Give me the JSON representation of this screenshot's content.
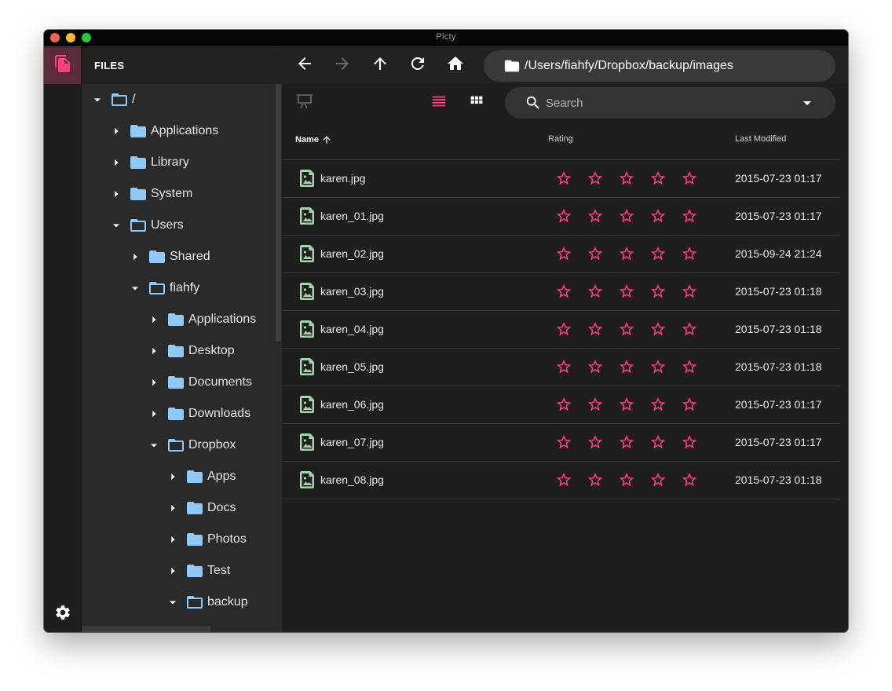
{
  "window": {
    "title": "Picty"
  },
  "colors": {
    "accent": "#ff4081",
    "folder": "#90caf9",
    "file_icon": "#a5d6a7"
  },
  "sidebar": {
    "title": "FILES",
    "tree": [
      {
        "label": "/",
        "depth": 0,
        "expanded": true
      },
      {
        "label": "Applications",
        "depth": 1,
        "expanded": false
      },
      {
        "label": "Library",
        "depth": 1,
        "expanded": false
      },
      {
        "label": "System",
        "depth": 1,
        "expanded": false
      },
      {
        "label": "Users",
        "depth": 1,
        "expanded": true
      },
      {
        "label": "Shared",
        "depth": 2,
        "expanded": false
      },
      {
        "label": "fiahfy",
        "depth": 2,
        "expanded": true
      },
      {
        "label": "Applications",
        "depth": 3,
        "expanded": false
      },
      {
        "label": "Desktop",
        "depth": 3,
        "expanded": false
      },
      {
        "label": "Documents",
        "depth": 3,
        "expanded": false
      },
      {
        "label": "Downloads",
        "depth": 3,
        "expanded": false
      },
      {
        "label": "Dropbox",
        "depth": 3,
        "expanded": true
      },
      {
        "label": "Apps",
        "depth": 4,
        "expanded": false
      },
      {
        "label": "Docs",
        "depth": 4,
        "expanded": false
      },
      {
        "label": "Photos",
        "depth": 4,
        "expanded": false
      },
      {
        "label": "Test",
        "depth": 4,
        "expanded": false
      },
      {
        "label": "backup",
        "depth": 4,
        "expanded": true
      }
    ]
  },
  "toolbar": {
    "path": "/Users/fiahfy/Dropbox/backup/images"
  },
  "search": {
    "placeholder": "Search"
  },
  "table": {
    "columns": {
      "name": "Name",
      "rating": "Rating",
      "modified": "Last Modified"
    },
    "rows": [
      {
        "name": "karen.jpg",
        "rating": 0,
        "modified": "2015-07-23 01:17"
      },
      {
        "name": "karen_01.jpg",
        "rating": 0,
        "modified": "2015-07-23 01:17"
      },
      {
        "name": "karen_02.jpg",
        "rating": 0,
        "modified": "2015-09-24 21:24"
      },
      {
        "name": "karen_03.jpg",
        "rating": 0,
        "modified": "2015-07-23 01:18"
      },
      {
        "name": "karen_04.jpg",
        "rating": 0,
        "modified": "2015-07-23 01:18"
      },
      {
        "name": "karen_05.jpg",
        "rating": 0,
        "modified": "2015-07-23 01:18"
      },
      {
        "name": "karen_06.jpg",
        "rating": 0,
        "modified": "2015-07-23 01:17"
      },
      {
        "name": "karen_07.jpg",
        "rating": 0,
        "modified": "2015-07-23 01:17"
      },
      {
        "name": "karen_08.jpg",
        "rating": 0,
        "modified": "2015-07-23 01:18"
      }
    ]
  }
}
